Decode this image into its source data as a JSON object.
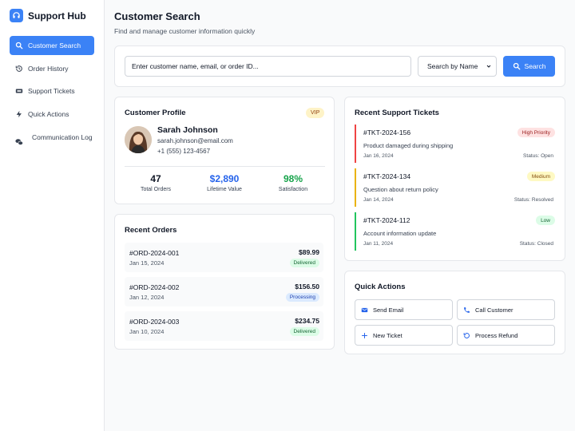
{
  "app": {
    "name": "Support Hub"
  },
  "sidebar": {
    "items": [
      {
        "label": "Customer Search",
        "icon": "search-icon",
        "active": true
      },
      {
        "label": "Order History",
        "icon": "history-icon"
      },
      {
        "label": "Support Tickets",
        "icon": "ticket-icon"
      },
      {
        "label": "Quick Actions",
        "icon": "bolt-icon"
      },
      {
        "label": "Communication Log",
        "icon": "chat-icon"
      }
    ]
  },
  "header": {
    "title": "Customer Search",
    "subtitle": "Find and manage customer information quickly"
  },
  "search": {
    "placeholder": "Enter customer name, email, or order ID...",
    "mode": "Search by Name",
    "button": "Search"
  },
  "profile": {
    "title": "Customer Profile",
    "badge": "VIP",
    "name": "Sarah Johnson",
    "email": "sarah.johnson@email.com",
    "phone": "+1 (555) 123-4567",
    "stats": [
      {
        "value": "47",
        "label": "Total Orders",
        "color": "#111827"
      },
      {
        "value": "$2,890",
        "label": "Lifetime Value",
        "color": "#2563eb"
      },
      {
        "value": "98%",
        "label": "Satisfaction",
        "color": "#16a34a"
      }
    ]
  },
  "orders": {
    "title": "Recent Orders",
    "items": [
      {
        "id": "#ORD-2024-001",
        "date": "Jan 15, 2024",
        "amount": "$89.99",
        "status": "Delivered"
      },
      {
        "id": "#ORD-2024-002",
        "date": "Jan 12, 2024",
        "amount": "$156.50",
        "status": "Processing"
      },
      {
        "id": "#ORD-2024-003",
        "date": "Jan 10, 2024",
        "amount": "$234.75",
        "status": "Delivered"
      }
    ]
  },
  "tickets": {
    "title": "Recent Support Tickets",
    "items": [
      {
        "id": "#TKT-2024-156",
        "priority": "High Priority",
        "desc": "Product damaged during shipping",
        "date": "Jan 16, 2024",
        "status": "Status: Open",
        "color": "#ef4444"
      },
      {
        "id": "#TKT-2024-134",
        "priority": "Medium",
        "desc": "Question about return policy",
        "date": "Jan 14, 2024",
        "status": "Status: Resolved",
        "color": "#eab308"
      },
      {
        "id": "#TKT-2024-112",
        "priority": "Low",
        "desc": "Account information update",
        "date": "Jan 11, 2024",
        "status": "Status: Closed",
        "color": "#22c55e"
      }
    ]
  },
  "quick_actions": {
    "title": "Quick Actions",
    "items": [
      {
        "label": "Send Email",
        "icon": "mail-icon"
      },
      {
        "label": "Call Customer",
        "icon": "phone-icon"
      },
      {
        "label": "New Ticket",
        "icon": "plus-icon"
      },
      {
        "label": "Process Refund",
        "icon": "refund-icon"
      }
    ]
  },
  "colors": {
    "accent": "#3b82f6"
  }
}
